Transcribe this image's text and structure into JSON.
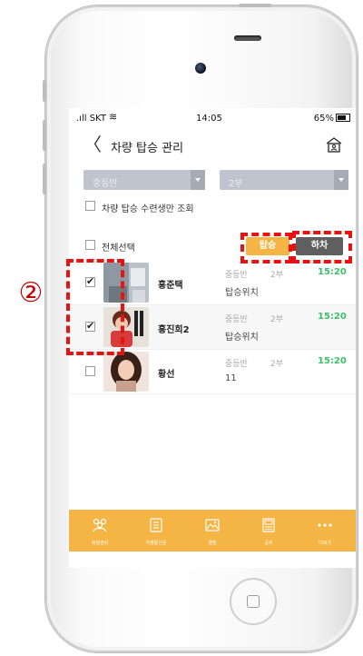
{
  "status_bar": {
    "carrier": ".ıll SKT",
    "time": "14:05",
    "battery": "65%"
  },
  "header": {
    "title": "차량 탑승 관리"
  },
  "filters": {
    "class_select": "중등반",
    "part_select": "2부",
    "only_applicants_label": "차량 탑승 수련생만 조회"
  },
  "select_all_label": "전체선택",
  "actions": {
    "board_label": "탑승",
    "alight_label": "하차"
  },
  "colors": {
    "accent": "#f5b545",
    "time_green": "#3bbf6a",
    "annotation_red": "#e81212"
  },
  "rows": [
    {
      "name": "홍준택",
      "class": "중등반",
      "part": "2부",
      "time": "15:20",
      "location": "탑승위치",
      "checked": true
    },
    {
      "name": "홍진희2",
      "class": "중등반",
      "part": "2부",
      "time": "15:20",
      "location": "탑승위치",
      "checked": true
    },
    {
      "name": "황선",
      "class": "중등반",
      "part": "2부",
      "time": "15:20",
      "location": "11",
      "checked": false
    }
  ],
  "tabbar": [
    {
      "label": "회원관리",
      "icon": "members-icon"
    },
    {
      "label": "가정통신문",
      "icon": "document-icon"
    },
    {
      "label": "앨범",
      "icon": "album-icon"
    },
    {
      "label": "공지",
      "icon": "notice-icon"
    },
    {
      "label": "더보기",
      "icon": "more-icon"
    }
  ],
  "annotation": {
    "marker": "②"
  }
}
